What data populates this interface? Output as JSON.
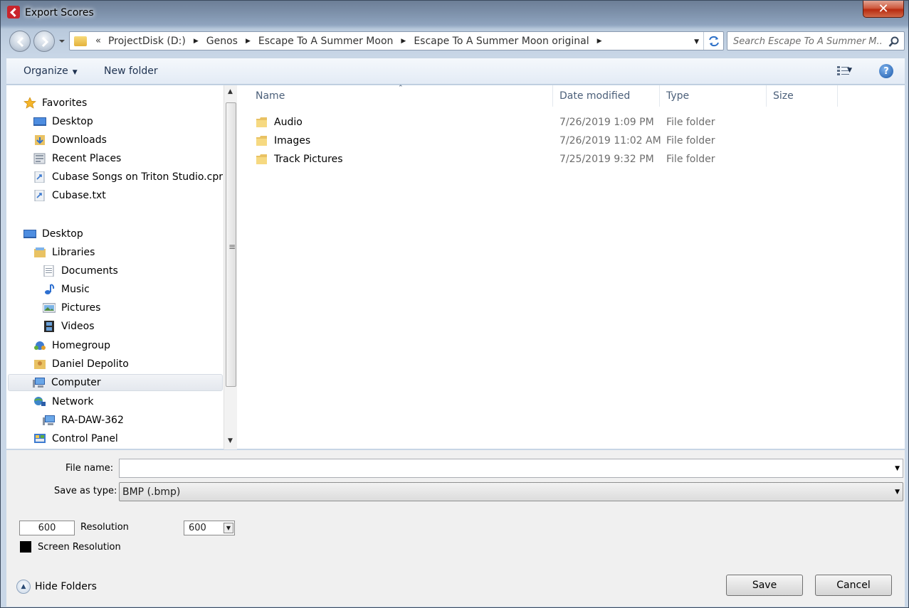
{
  "window": {
    "title": "Export Scores"
  },
  "address_bar": {
    "overflow_chevron": "«",
    "breadcrumbs": [
      "ProjectDisk (D:)",
      "Genos",
      "Escape To A Summer Moon",
      "Escape To A Summer Moon original"
    ],
    "search_placeholder": "Search Escape To A Summer M..."
  },
  "toolbar": {
    "organize_label": "Organize",
    "new_folder_label": "New folder",
    "help": "?"
  },
  "nav_pane": {
    "favorites": {
      "label": "Favorites",
      "items": [
        "Desktop",
        "Downloads",
        "Recent Places",
        "Cubase Songs on Triton Studio.cpr",
        "Cubase.txt"
      ]
    },
    "desktop": {
      "label": "Desktop"
    },
    "libraries": {
      "label": "Libraries",
      "items": [
        "Documents",
        "Music",
        "Pictures",
        "Videos"
      ]
    },
    "homegroup": "Homegroup",
    "user": "Daniel Depolito",
    "computer": "Computer",
    "network": {
      "label": "Network",
      "items": [
        "RA-DAW-362"
      ]
    },
    "control_panel": "Control Panel"
  },
  "file_list": {
    "columns": [
      "Name",
      "Date modified",
      "Type",
      "Size"
    ],
    "rows": [
      {
        "name": "Audio",
        "date": "7/26/2019 1:09 PM",
        "type": "File folder"
      },
      {
        "name": "Images",
        "date": "7/26/2019 11:02 AM",
        "type": "File folder"
      },
      {
        "name": "Track Pictures",
        "date": "7/25/2019 9:32 PM",
        "type": "File folder"
      }
    ]
  },
  "form": {
    "file_name_label": "File name:",
    "file_name_value": "",
    "save_type_label": "Save as type:",
    "save_type_value": "BMP (.bmp)",
    "resolution_value": "600",
    "resolution_label": "Resolution",
    "resolution_select_value": "600",
    "screen_resolution_label": "Screen Resolution"
  },
  "footer": {
    "hide_folders_label": "Hide Folders",
    "save_label": "Save",
    "cancel_label": "Cancel"
  },
  "colors": {
    "selection": "#e4e8ee",
    "toolbar_text": "#1e3250",
    "header_text": "#4c607a",
    "close_button": "#c53a1e"
  }
}
